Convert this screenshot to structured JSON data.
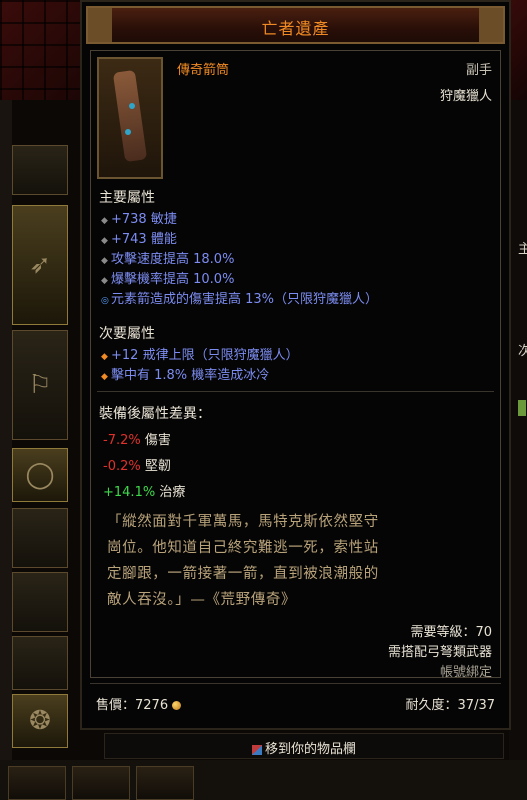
{
  "title": "亡者遺產",
  "item": {
    "name": "傳奇箭筒",
    "slot_type": "副手",
    "class": "狩魔獵人"
  },
  "primary": {
    "heading": "主要屬性",
    "stats": [
      "+738 敏捷",
      "+743 體能",
      "攻擊速度提高 18.0%",
      "爆擊機率提高 10.0%",
      "元素箭造成的傷害提高 13%（只限狩魔獵人）"
    ]
  },
  "secondary": {
    "heading": "次要屬性",
    "stats": [
      "+12 戒律上限（只限狩魔獵人）",
      "擊中有 1.8% 機率造成冰冷"
    ]
  },
  "compare": {
    "heading": "裝備後屬性差異：",
    "rows": [
      {
        "value": "-7.2%",
        "label": "傷害"
      },
      {
        "value": "-0.2%",
        "label": "堅韌"
      },
      {
        "value": "+14.1%",
        "label": "治療"
      }
    ]
  },
  "flavor": {
    "lines": [
      "「縱然面對千軍萬馬，馬特克斯依然堅守",
      "崗位。他知道自己終究難逃一死，索性站",
      "定腳跟，一箭接著一箭，直到被浪潮般的",
      "敵人吞沒。」—《荒野傳奇》"
    ]
  },
  "requirements": {
    "level": "需要等級：70",
    "weapon": "需搭配弓弩類武器",
    "bound": "帳號綁定"
  },
  "footer": {
    "price": "售價：7276",
    "durability": "耐久度：37/37"
  },
  "move_button": "移到你的物品欄",
  "colors": {
    "legendary": "#f08a24",
    "magic_blue": "#7c8cf0",
    "negative": "#e0312b",
    "positive": "#3ed94a",
    "flavor": "#b8a27a"
  }
}
